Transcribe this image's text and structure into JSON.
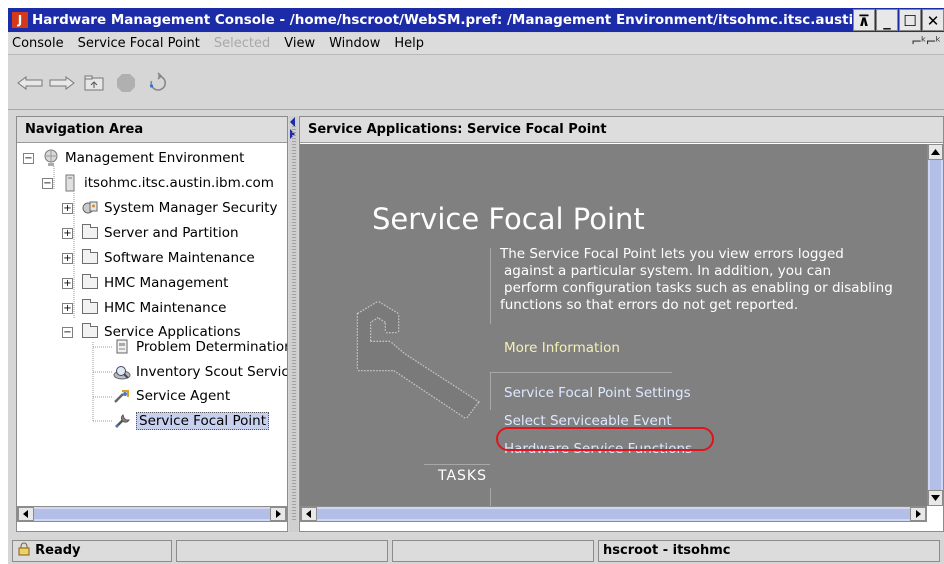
{
  "window": {
    "title": "Hardware Management Console - /home/hscroot/WebSM.pref: /Management Environment/itsohmc.itsc.austin.ibm.com/Service Applications/Service Focal Point",
    "app_icon": "J",
    "controls": {
      "pin": "⊼",
      "minimize": "_",
      "maximize": "☐",
      "close": "✕"
    }
  },
  "menubar": {
    "items": [
      {
        "label": "Console",
        "enabled": true
      },
      {
        "label": "Service Focal Point",
        "enabled": true
      },
      {
        "label": "Selected",
        "enabled": false
      },
      {
        "label": "View",
        "enabled": true
      },
      {
        "label": "Window",
        "enabled": true
      },
      {
        "label": "Help",
        "enabled": true
      }
    ],
    "right_icons": "⌐ᵏ⌐ᵏ"
  },
  "toolbar": {
    "buttons": [
      "back-arrow-icon",
      "forward-arrow-icon",
      "up-folder-icon",
      "stop-icon",
      "refresh-icon"
    ]
  },
  "navigation": {
    "header": "Navigation Area",
    "tree": [
      {
        "label": "Management Environment",
        "level": 0,
        "expander": "−",
        "icon": "globe-icon"
      },
      {
        "label": "itsohmc.itsc.austin.ibm.com",
        "level": 1,
        "expander": "−",
        "icon": "server-icon"
      },
      {
        "label": "System Manager Security",
        "level": 2,
        "expander": "+",
        "icon": "security-icon"
      },
      {
        "label": "Server and Partition",
        "level": 2,
        "expander": "+",
        "icon": "folder-icon"
      },
      {
        "label": "Software Maintenance",
        "level": 2,
        "expander": "+",
        "icon": "folder-icon"
      },
      {
        "label": "HMC Management",
        "level": 2,
        "expander": "+",
        "icon": "folder-icon"
      },
      {
        "label": "HMC Maintenance",
        "level": 2,
        "expander": "+",
        "icon": "folder-icon"
      },
      {
        "label": "Service Applications",
        "level": 2,
        "expander": "−",
        "icon": "folder-icon"
      },
      {
        "label": "Problem Determination",
        "level": 3,
        "expander": "",
        "icon": "document-icon"
      },
      {
        "label": "Inventory Scout Services",
        "level": 3,
        "expander": "",
        "icon": "inventory-icon"
      },
      {
        "label": "Service Agent",
        "level": 3,
        "expander": "",
        "icon": "agent-icon"
      },
      {
        "label": "Service Focal Point",
        "level": 3,
        "expander": "",
        "icon": "wrench-icon",
        "selected": true
      }
    ]
  },
  "main": {
    "header": "Service Applications: Service Focal Point",
    "title": "Service Focal Point",
    "description_lines": [
      "The Service Focal Point lets you view errors logged",
      " against a particular system. In addition, you can",
      " perform configuration tasks such as enabling or disabling",
      "functions so that errors do not get reported."
    ],
    "more_info": "More Information",
    "tasks_label": "TASKS",
    "tasks": [
      "Service Focal Point Settings",
      "Select Serviceable Event",
      "Hardware Service Functions"
    ],
    "highlighted_task_index": 2,
    "colors": {
      "content_bg": "#808080",
      "highlight": "#e0141c",
      "link": "#dde8ff",
      "more_info": "#f3f0b6"
    }
  },
  "status": {
    "icon": "lock-icon",
    "text": "Ready",
    "user": "hscroot - itsohmc"
  }
}
